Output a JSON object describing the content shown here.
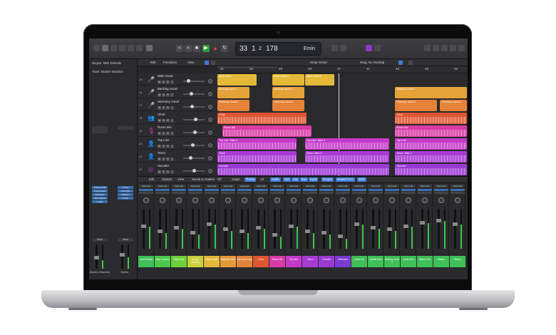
{
  "lcd": {
    "bar": "33",
    "beat": "1",
    "sub": "2",
    "tempo": "178",
    "key": "Emin"
  },
  "inspector": {
    "region_label": "Region: MIDI Defaults",
    "track_label": "Track: Modern Machine",
    "strip_names": [
      "Modern Machine",
      "Stereo"
    ],
    "plugin_slots_left": [
      "Channel EQ",
      "Compressor",
      "Enhancer",
      "ChromaVerb",
      "Limiter"
    ],
    "plugin_slots_right": [
      "Limiter",
      "Level Met",
      "Analyzer",
      "Limiter"
    ],
    "read_labels": [
      "Read",
      "Read"
    ]
  },
  "track_bar": {
    "edit": "Edit",
    "functions": "Functions",
    "view": "View",
    "snap_label": "Snap:",
    "snap_value": "Smart",
    "drag_label": "Drag:",
    "drag_value": "No Overlap"
  },
  "ruler": [
    "21",
    "25",
    "29",
    "33",
    "37",
    "41",
    "45",
    "49",
    "53"
  ],
  "tracks": [
    {
      "num": "15",
      "name": "Main Vocal",
      "icon": "microphone-icon",
      "color": "#e0b23a",
      "pan": 0.2
    },
    {
      "num": "16",
      "name": "Backing Vocal",
      "icon": "microphone-icon",
      "color": "#e0b23a",
      "pan": 0.35
    },
    {
      "num": "17",
      "name": "Harmony Vocal",
      "icon": "microphone-icon",
      "color": "#e0b23a",
      "pan": 0.4
    },
    {
      "num": "18",
      "name": "Choir",
      "icon": "choir-icon",
      "color": "#e06a3a",
      "pan": 0.6
    },
    {
      "num": "19",
      "name": "Room Mic",
      "icon": "mic-stand-icon",
      "color": "#d43aa8",
      "pan": 0.55
    },
    {
      "num": "20",
      "name": "Top Line",
      "icon": "person-icon",
      "color": "#b83ad4",
      "pan": 0.45
    },
    {
      "num": "21",
      "name": "Tenor",
      "icon": "person-icon",
      "color": "#b83ad4",
      "pan": 0.3
    },
    {
      "num": "22",
      "name": "Vocoder",
      "icon": "vocoder-icon",
      "color": "#b83ad4",
      "pan": 0.5
    }
  ],
  "regions": [
    {
      "lane": 0,
      "name": "Main Vocal",
      "color": "#e5b938",
      "start": 0.0,
      "width": 0.16
    },
    {
      "lane": 0,
      "name": "Main Vocal 3",
      "color": "#e5b938",
      "start": 0.22,
      "width": 0.13
    },
    {
      "lane": 0,
      "name": "Main Vocal 5",
      "color": "#e5b938",
      "start": 0.35,
      "width": 0.12
    },
    {
      "lane": 1,
      "name": "Backing Vocal 1",
      "color": "#e5a238",
      "start": 0.0,
      "width": 0.13
    },
    {
      "lane": 1,
      "name": "Backing Vocal 2",
      "color": "#e5a238",
      "start": 0.22,
      "width": 0.13
    },
    {
      "lane": 1,
      "name": "Backing Vocal 3",
      "color": "#e5a238",
      "start": 0.71,
      "width": 0.29
    },
    {
      "lane": 2,
      "name": "Harmony Vocal 1",
      "color": "#e5823a",
      "start": 0.0,
      "width": 0.13
    },
    {
      "lane": 2,
      "name": "Harmony Vocal 2",
      "color": "#e5823a",
      "start": 0.22,
      "width": 0.13
    },
    {
      "lane": 2,
      "name": "Harmony Vocal 3",
      "color": "#e5823a",
      "start": 0.71,
      "width": 0.17
    },
    {
      "lane": 2,
      "name": "Harmony Vocal 4",
      "color": "#e5823a",
      "start": 0.89,
      "width": 0.11
    },
    {
      "lane": 3,
      "name": "Choir",
      "color": "#e05632",
      "start": 0.0,
      "width": 0.36
    },
    {
      "lane": 3,
      "name": "Choir",
      "color": "#e05632",
      "start": 0.71,
      "width": 0.29
    },
    {
      "lane": 4,
      "name": "Room Mic",
      "color": "#d93aa6",
      "start": 0.02,
      "width": 0.36
    },
    {
      "lane": 4,
      "name": "Room Mic",
      "color": "#d93aa6",
      "start": 0.71,
      "width": 0.29
    },
    {
      "lane": 5,
      "name": "Top Line: Take 4",
      "color": "#c43ac8",
      "start": 0.0,
      "width": 0.32
    },
    {
      "lane": 5,
      "name": "Top Line: Take 4",
      "color": "#c43ac8",
      "start": 0.35,
      "width": 0.34
    },
    {
      "lane": 5,
      "name": "Top Line",
      "color": "#c43ac8",
      "start": 0.71,
      "width": 0.29
    },
    {
      "lane": 6,
      "name": "Tenor",
      "color": "#a93ad4",
      "start": 0.0,
      "width": 0.32
    },
    {
      "lane": 6,
      "name": "Tenor: Take 3",
      "color": "#a93ad4",
      "start": 0.35,
      "width": 0.34
    },
    {
      "lane": 6,
      "name": "Tenor: Take 2",
      "color": "#a93ad4",
      "start": 0.71,
      "width": 0.29
    },
    {
      "lane": 7,
      "name": "Vocoder",
      "color": "#9a3ad4",
      "start": 0.0,
      "width": 0.69
    },
    {
      "lane": 7,
      "name": "Vocoder",
      "color": "#9a3ad4",
      "start": 0.71,
      "width": 0.29
    }
  ],
  "mixer": {
    "tabs": [
      "Edit",
      "Options",
      "View",
      "Sends on Faders",
      "Off",
      "Single",
      "Tracks",
      "All",
      "Audio",
      "Inst",
      "Aux",
      "Bus",
      "Input",
      "Output",
      "Master/VCA",
      "MIDI"
    ],
    "active_tabs": [
      "Tracks",
      "Audio",
      "Inst",
      "Aux",
      "Bus",
      "Input",
      "Output",
      "Master/VCA",
      "MIDI"
    ],
    "strip_setting": "Surround",
    "strips": [
      {
        "label": "Vocal Stacks",
        "color": "#3fbf58",
        "level": 0.55
      },
      {
        "label": "Saw Crunchy",
        "color": "#4ac94a",
        "level": 0.4
      },
      {
        "label": "Alive Pad",
        "color": "#6ed13a",
        "level": 0.5
      },
      {
        "label": "Analog Backing",
        "color": "#c9d13a",
        "level": 0.35
      },
      {
        "label": "Main Vocal",
        "color": "#e5b938",
        "level": 0.6
      },
      {
        "label": "Backing Vocal",
        "color": "#e59a38",
        "level": 0.45
      },
      {
        "label": "Harmony Vocal",
        "color": "#e5823a",
        "level": 0.4
      },
      {
        "label": "Choir",
        "color": "#e05632",
        "level": 0.5
      },
      {
        "label": "Room Mic",
        "color": "#d93aa6",
        "level": 0.3
      },
      {
        "label": "Top Line",
        "color": "#c43ac8",
        "level": 0.55
      },
      {
        "label": "Tenor",
        "color": "#a93ad4",
        "level": 0.4
      },
      {
        "label": "Vocoder",
        "color": "#9a3ad4",
        "level": 0.35
      },
      {
        "label": "Sidechain",
        "color": "#7a3ad4",
        "level": 0.25
      },
      {
        "label": "Vocal Vox",
        "color": "#3fbf58",
        "level": 0.6
      },
      {
        "label": "Spatial Verb",
        "color": "#3fbf58",
        "level": 0.5
      },
      {
        "label": "Backing Vocal 2",
        "color": "#3fbf58",
        "level": 0.45
      },
      {
        "label": "Vocal Verb",
        "color": "#3fbf58",
        "level": 0.55
      },
      {
        "label": "Stereo Out",
        "color": "#3fbf58",
        "level": 0.65
      },
      {
        "label": "Master",
        "color": "#3fbf58",
        "level": 0.7
      },
      {
        "label": "Stereo",
        "color": "#3fbf58",
        "level": 0.6
      }
    ]
  }
}
